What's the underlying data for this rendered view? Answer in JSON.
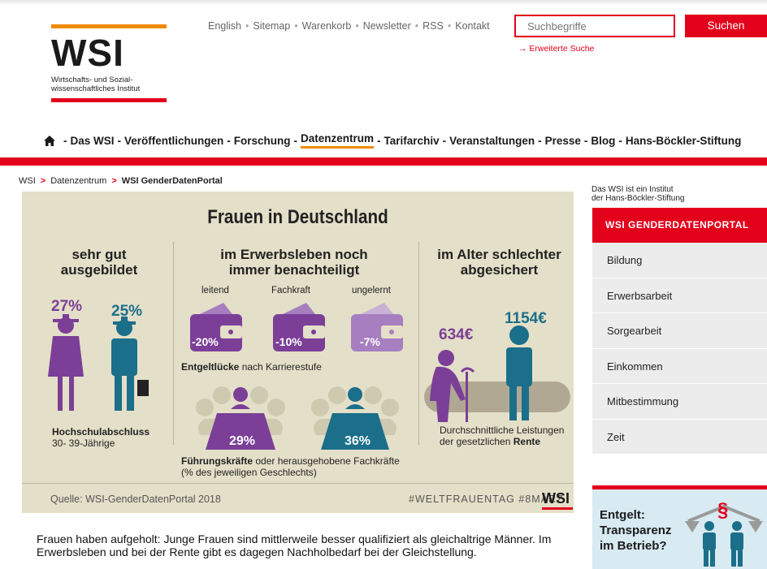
{
  "logo": {
    "name": "WSI",
    "subtitle_line1": "Wirtschafts- und Sozial-",
    "subtitle_line2": "wissenschaftliches Institut"
  },
  "utility_nav": [
    "English",
    "Sitemap",
    "Warenkorb",
    "Newsletter",
    "RSS",
    "Kontakt"
  ],
  "search": {
    "placeholder": "Suchbegriffe",
    "button": "Suchen",
    "advanced": "→ Erweiterte Suche"
  },
  "main_nav": [
    "Das WSI",
    "Veröffentlichungen",
    "Forschung",
    "Datenzentrum",
    "Tarifarchiv",
    "Veranstaltungen",
    "Presse",
    "Blog",
    "Hans-Böckler-Stiftung"
  ],
  "main_nav_active": "Datenzentrum",
  "breadcrumb": {
    "home": "WSI",
    "level1": "Datenzentrum",
    "current": "WSI GenderDatenPortal"
  },
  "infographic": {
    "title": "Frauen in Deutschland",
    "col1_heading_1": "sehr gut",
    "col1_heading_2": "ausgebildet",
    "col2_heading_1": "im Erwerbsleben noch",
    "col2_heading_2": "immer benachteiligt",
    "col3_heading_1": "im Alter schlechter",
    "col3_heading_2": "abgesichert",
    "edu_women_pct": "27%",
    "edu_men_pct": "25%",
    "edu_caption_1": "Hochschulabschluss",
    "edu_caption_2": "30- 39-Jährige",
    "level_1": "leitend",
    "level_2": "Fachkraft",
    "level_3": "ungelernt",
    "gap_1": "-20%",
    "gap_2": "-10%",
    "gap_3": "-7%",
    "gap_caption_bold": "Entgeltlücke",
    "gap_caption_rest": " nach Karrierestufe",
    "lead_women_pct": "29%",
    "lead_men_pct": "36%",
    "lead_caption_bold": "Führungskräfte",
    "lead_caption_rest": " oder herausgehobene Fachkräfte",
    "lead_caption_2": "(% des jeweiligen Geschlechts)",
    "pension_women": "634€",
    "pension_men": "1154€",
    "pension_caption_1": "Durchschnittliche Leistungen",
    "pension_caption_2a": "der gesetzlichen ",
    "pension_caption_2b": "Rente",
    "source": "Quelle: WSI-GenderDatenPortal 2018",
    "hashtags": "#WELTFRAUENTAG #8MÄRZ",
    "mini_logo": "WSI",
    "colors": {
      "women": "#7b3f98",
      "men": "#1b6f8a",
      "women_light": "#a77fc0",
      "background": "#e4dfc8"
    }
  },
  "body_text": "Frauen haben aufgeholt: Junge Frauen sind mittlerweile besser qualifiziert als gleichaltrige Männer. Im Erwerbsleben und bei der Rente gibt es dagegen Nachholbedarf bei der Gleichstellung.",
  "sidebar": {
    "note_1": "Das WSI ist ein Institut",
    "note_2": "der Hans-Böckler-Stiftung",
    "menu_title": "WSI GENDERDATENPORTAL",
    "menu_items": [
      "Bildung",
      "Erwerbsarbeit",
      "Sorgearbeit",
      "Einkommen",
      "Mitbestimmung",
      "Zeit"
    ],
    "ad_line1": "Entgelt:",
    "ad_line2": "Transparenz",
    "ad_line3": "im Betrieb?",
    "ad_symbol": "§"
  }
}
